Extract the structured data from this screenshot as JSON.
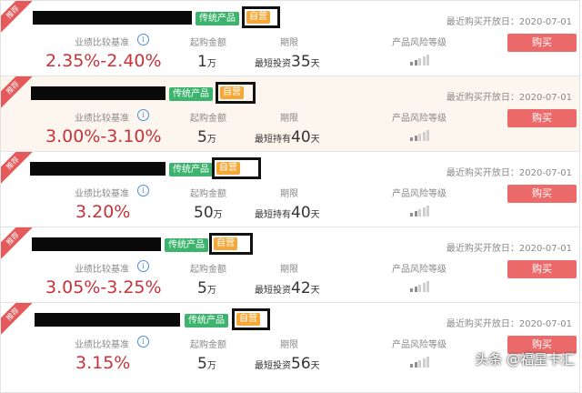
{
  "common": {
    "tag_traditional": "传统产品",
    "tag_self": "自营",
    "date_label": "最近购买开放日：2020-07-01",
    "label_benchmark": "业绩比较基准",
    "label_min_amount": "起购金额",
    "label_term": "期限",
    "label_risk": "产品风险等级",
    "buy_label": "购买",
    "ribbon": "推荐",
    "unit_wan": "万",
    "unit_day": "天",
    "info_glyph": "i"
  },
  "products": [
    {
      "rate": "2.35%-2.40%",
      "amount": "1",
      "term_prefix": "最短投资",
      "term_days": "35",
      "risk_level": 2
    },
    {
      "rate": "3.00%-3.10%",
      "amount": "5",
      "term_prefix": "最短持有",
      "term_days": "40",
      "risk_level": 2
    },
    {
      "rate": "3.20%",
      "amount": "50",
      "term_prefix": "最短持有",
      "term_days": "40",
      "risk_level": 2
    },
    {
      "rate": "3.05%-3.25%",
      "amount": "5",
      "term_prefix": "最短投资",
      "term_days": "42",
      "risk_level": 2
    },
    {
      "rate": "3.15%",
      "amount": "5",
      "term_prefix": "最短投资",
      "term_days": "56",
      "risk_level": 2
    }
  ],
  "watermark": "头条 @福星卡汇"
}
